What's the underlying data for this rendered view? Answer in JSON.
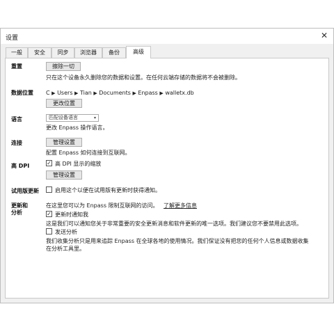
{
  "window": {
    "title": "设置",
    "close_glyph": "✕"
  },
  "tabs": [
    "一般",
    "安全",
    "同步",
    "浏览器",
    "备份",
    "高级"
  ],
  "active_tab": "高级",
  "reset": {
    "label": "重置",
    "button": "擦除一切",
    "desc": "只在这个设备永久删除您的数据和设置。在任何云端存储的数据将不会被删除。"
  },
  "data_location": {
    "label": "数据位置",
    "path_parts": [
      "C",
      "Users",
      "Tian",
      "Documents",
      "Enpass",
      "walletx.db"
    ],
    "separator": "▶",
    "button": "更改位置"
  },
  "language": {
    "label": "语言",
    "selected": "匹配设备语言",
    "desc": "更改 Enpass 操作语言。"
  },
  "connection": {
    "label": "连接",
    "button": "管理设置",
    "desc": "配置 Enpass 如何连接到互联网。"
  },
  "high_dpi": {
    "label": "高 DPI",
    "checkbox_label": "高 DPI 显示的缩放",
    "checked": true,
    "button": "管理设置"
  },
  "trial_update": {
    "label": "试用版更新",
    "checkbox_label": "启用这个以便在试用版有更新时获得通知。",
    "checked": false
  },
  "updates_analytics": {
    "label_line1": "更新和",
    "label_line2": "分析",
    "intro": "在这里您可以为 Enpass 限制互联网的访问。",
    "learn_more": "了解更多信息",
    "notify_label": "更新时通知我",
    "notify_checked": true,
    "notify_desc": "这是我们可以通知您关于非常重要的安全更新消息和软件更新的唯一选项。我们建议您不要禁用此选项。",
    "analytics_label": "发送分析",
    "analytics_checked": false,
    "analytics_desc_line1": "我们收集分析只是用来追踪 Enpass 在全球各地的使用情况。我们保证没有把您的任何个人信息或数据收集",
    "analytics_desc_line2": "在分析工具里。"
  }
}
